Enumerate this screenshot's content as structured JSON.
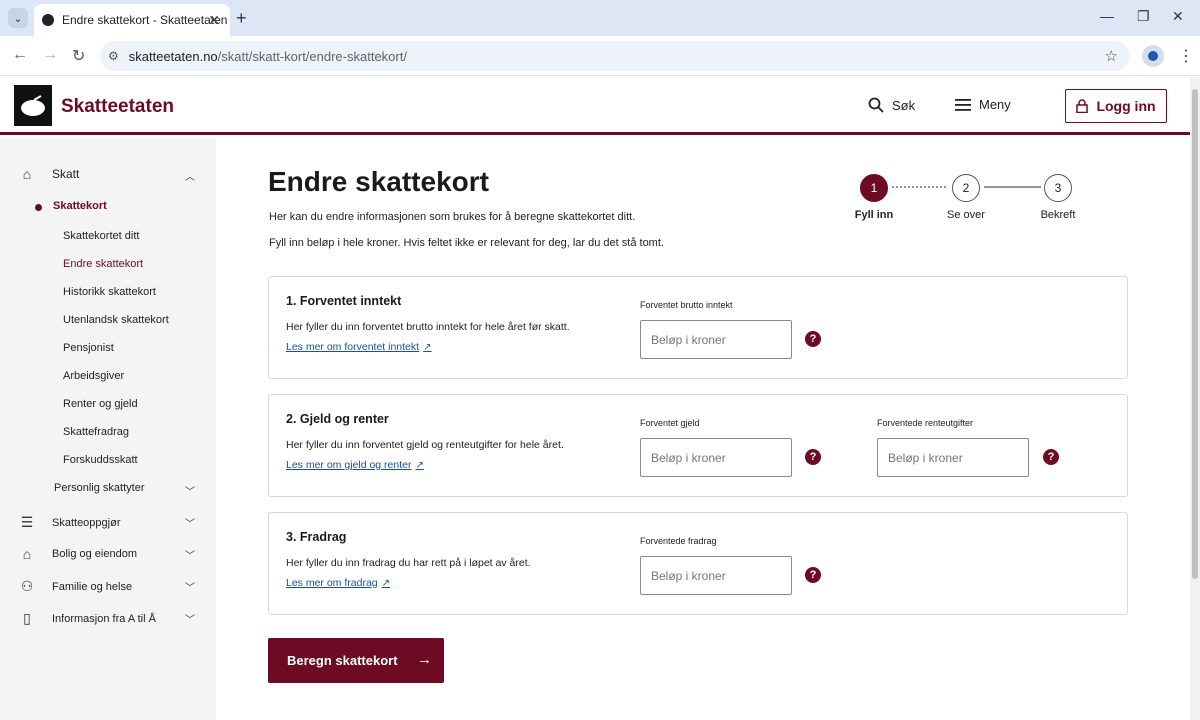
{
  "browser": {
    "tab_title": "Endre skattekort - Skatteetaten",
    "url_host": "skatteetaten.no",
    "url_path": "/skatt/skatt-kort/endre-skattekort/"
  },
  "header": {
    "brand": "Skatteetaten",
    "search_label": "Søk",
    "menu_label": "Meny",
    "login_label": "Logg inn"
  },
  "sidebar": {
    "top_items": [
      {
        "label": "Skatt",
        "icon": "house-icon",
        "expanded": true
      },
      {
        "label": "Skatteoppgjør",
        "icon": "coins-icon"
      },
      {
        "label": "Bolig og eiendom",
        "icon": "house-icon"
      },
      {
        "label": "Familie og helse",
        "icon": "people-icon"
      },
      {
        "label": "Informasjon fra A til Å",
        "icon": "document-icon"
      }
    ],
    "section": "Skattekort",
    "sub_items": [
      "Skattekortet ditt",
      "Endre skattekort",
      "Historikk skattekort",
      "Utenlandsk skattekort",
      "Pensjonist",
      "Arbeidsgiver",
      "Renter og gjeld",
      "Skattefradrag",
      "Forskuddsskatt"
    ],
    "active_sub": "Endre skattekort",
    "personlig": "Personlig skattyter"
  },
  "main": {
    "title": "Endre skattekort",
    "intro1": "Her kan du endre informasjonen som brukes for å beregne skattekortet ditt.",
    "intro2": "Fyll inn beløp i hele kroner. Hvis feltet ikke er relevant for deg, lar du det stå tomt.",
    "steps": [
      {
        "num": "1",
        "label": "Fyll inn",
        "active": true
      },
      {
        "num": "2",
        "label": "Se over"
      },
      {
        "num": "3",
        "label": "Bekreft"
      }
    ],
    "placeholder": "Beløp i kroner",
    "cards": [
      {
        "heading": "1. Forventet inntekt",
        "desc": "Her fyller du inn forventet brutto inntekt for hele året før skatt.",
        "link": "Les mer om forventet inntekt",
        "fields": [
          "Forventet brutto inntekt"
        ]
      },
      {
        "heading": "2. Gjeld og renter",
        "desc": "Her fyller du inn forventet gjeld og renteutgifter for hele året.",
        "link": "Les mer om gjeld og renter",
        "fields": [
          "Forventet gjeld",
          "Forventede renteutgifter"
        ]
      },
      {
        "heading": "3. Fradrag",
        "desc": "Her fyller du inn fradrag du har rett på i løpet av året.",
        "link": "Les mer om fradrag",
        "fields": [
          "Forventede fradrag"
        ]
      }
    ],
    "cta_label": "Beregn skattekort",
    "help_glyph": "?"
  },
  "colors": {
    "brand": "#6d0a24",
    "link": "#1a4fa0"
  }
}
